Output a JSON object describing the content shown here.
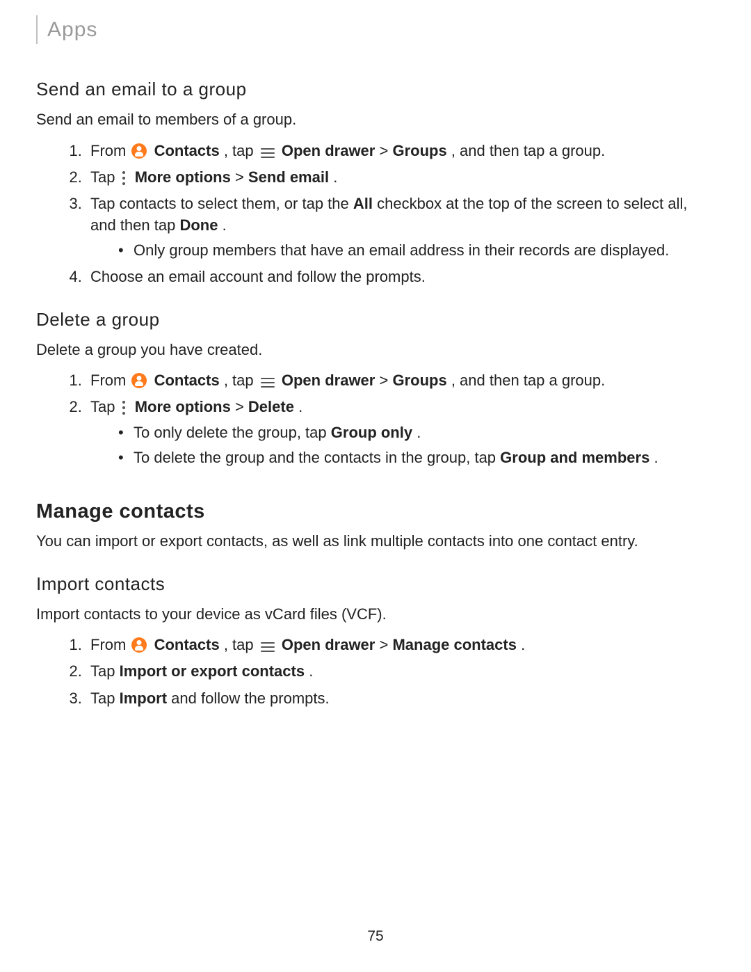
{
  "breadcrumb": "Apps",
  "page_number": "75",
  "sec1": {
    "h": "Send an email to a group",
    "p": "Send an email to members of a group.",
    "s1": {
      "a": "From ",
      "b": "Contacts",
      "c": ", tap ",
      "d": "Open drawer",
      "e": " > ",
      "f": "Groups",
      "g": ", and then tap a group."
    },
    "s2": {
      "a": "Tap ",
      "b": "More options",
      "c": " > ",
      "d": "Send email",
      "e": "."
    },
    "s3": {
      "a": "Tap contacts to select them, or tap the ",
      "b": "All",
      "c": " checkbox at the top of the screen to select all, and then tap ",
      "d": "Done",
      "e": "."
    },
    "s3b": "Only group members that have an email address in their records are displayed.",
    "s4": "Choose an email account and follow the prompts."
  },
  "sec2": {
    "h": "Delete a group",
    "p": "Delete a group you have created.",
    "s1": {
      "a": "From ",
      "b": "Contacts",
      "c": ", tap ",
      "d": "Open drawer",
      "e": " > ",
      "f": "Groups",
      "g": ", and then tap a group."
    },
    "s2": {
      "a": "Tap ",
      "b": "More options",
      "c": " > ",
      "d": "Delete",
      "e": "."
    },
    "b1": {
      "a": "To only delete the group, tap ",
      "b": "Group only",
      "c": "."
    },
    "b2": {
      "a": "To delete the group and the contacts in the group, tap ",
      "b": "Group and members",
      "c": "."
    }
  },
  "sec3": {
    "h": "Manage contacts",
    "p": "You can import or export contacts, as well as link multiple contacts into one contact entry."
  },
  "sec4": {
    "h": "Import contacts",
    "p": "Import contacts to your device as vCard files (VCF).",
    "s1": {
      "a": "From ",
      "b": "Contacts",
      "c": ", tap ",
      "d": "Open drawer",
      "e": " > ",
      "f": "Manage contacts",
      "g": "."
    },
    "s2": {
      "a": "Tap ",
      "b": "Import or export contacts",
      "c": "."
    },
    "s3": {
      "a": "Tap ",
      "b": "Import",
      "c": " and follow the prompts."
    }
  }
}
